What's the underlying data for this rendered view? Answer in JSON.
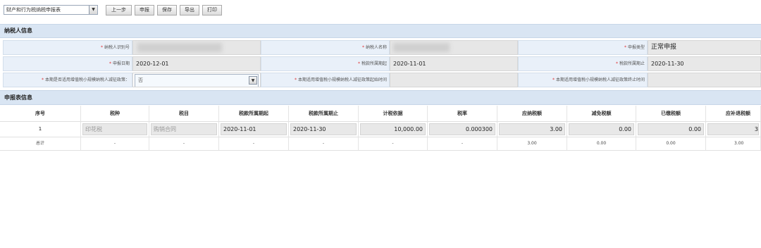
{
  "toolbar": {
    "report_select": "财产和行为税纳税申报表",
    "buttons": [
      "上一步",
      "申报",
      "保存",
      "导出",
      "打印"
    ]
  },
  "taxpayer_section": {
    "title": "纳税人信息",
    "rows": [
      [
        {
          "label": "纳税人识别号",
          "value": ""
        },
        {
          "label": "纳税人名称",
          "value": ""
        },
        {
          "label": "申报类型",
          "value": "正常申报"
        }
      ],
      [
        {
          "label": "申报日期",
          "value": "2020-12-01"
        },
        {
          "label": "税款所属期起",
          "value": "2020-11-01"
        },
        {
          "label": "税款所属期止",
          "value": "2020-11-30"
        }
      ],
      [
        {
          "label": "本期是否适用增值税小规模纳税人减征政策：",
          "value": "否"
        },
        {
          "label": "本期适用增值税小规模纳税人减征政策起始时间",
          "value": ""
        },
        {
          "label": "本期适用增值税小规模纳税人减征政策终止时间",
          "value": ""
        }
      ]
    ]
  },
  "declaration_section": {
    "title": "申报表信息",
    "columns": [
      "序号",
      "税种",
      "税目",
      "税款所属期起",
      "税款所属期止",
      "计税依据",
      "税率",
      "应纳税额",
      "减免税额",
      "已缴税额",
      "应补退税额"
    ],
    "row": {
      "seq": "1",
      "tax_type": "印花税",
      "tax_item": "购销合同",
      "period_start": "2020-11-01",
      "period_end": "2020-11-30",
      "basis": "10,000.00",
      "rate": "0.000300",
      "payable": "3.00",
      "reduction": "0.00",
      "paid": "0.00",
      "refund": "3"
    },
    "total": {
      "label": "总计",
      "tax_type": "-",
      "tax_item": "-",
      "period_start": "-",
      "period_end": "-",
      "basis": "-",
      "rate": "-",
      "payable": "3.00",
      "reduction": "0.00",
      "paid": "0.00",
      "refund": "3.00"
    }
  }
}
